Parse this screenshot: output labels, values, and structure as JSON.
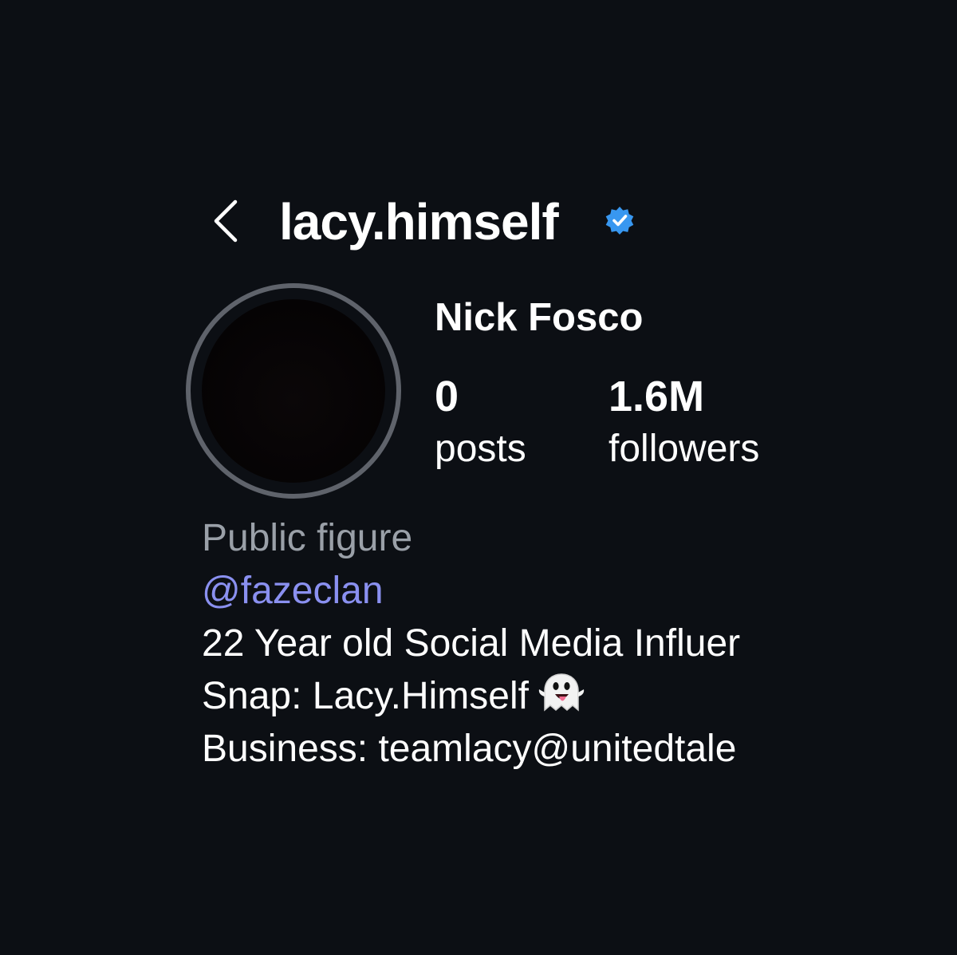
{
  "header": {
    "username": "lacy.himself",
    "verified": true,
    "verified_color": "#3897f0",
    "back_icon": "chevron-left-icon"
  },
  "profile": {
    "full_name": "Nick Fosco",
    "avatar_ring_color": "#5f636b"
  },
  "stats": [
    {
      "value": "0",
      "label": "posts"
    },
    {
      "value": "1.6M",
      "label": "followers"
    }
  ],
  "bio": {
    "category": "Public figure",
    "mention": "@fazeclan",
    "mention_color": "#8a90f0",
    "line1": "22 Year old Social Media Influer",
    "line2": "Snap: Lacy.Himself",
    "line2_icon": "ghost-icon",
    "line3": "Business: teamlacy@unitedtale"
  },
  "theme": {
    "background": "#0c0f14",
    "text": "#ffffff",
    "secondary_text": "#9aa0a8"
  }
}
